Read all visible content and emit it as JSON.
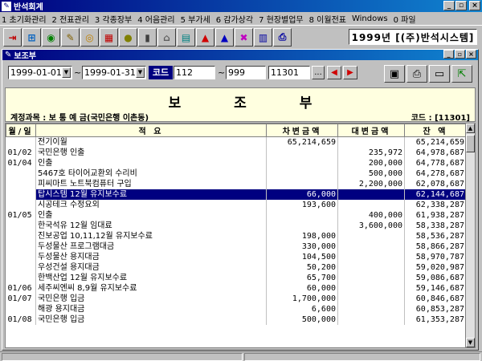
{
  "app": {
    "title": "반석회계"
  },
  "menu": [
    "1 초기화관리",
    "2 전표관리",
    "3 각종장부",
    "4 어음관리",
    "5 부가세",
    "6 감가상각",
    "7 현장별업무",
    "8 이월전표",
    "Windows",
    "0 파일"
  ],
  "toolbar": {
    "company": "1999년 [(주)반석시스템]"
  },
  "window": {
    "title": "보조부"
  },
  "filter": {
    "date_from": "1999-01-01",
    "tilde1": "~",
    "date_to": "1999-01-31",
    "code_label": "코드",
    "code_from": "112",
    "tilde2": "~",
    "code_to": "999",
    "account_code": "11301",
    "browse": "..."
  },
  "report": {
    "title": "보 조 부",
    "account": "계정과목 : 보 통 예 금(국민은행 이촌동)",
    "code": "코드 : [11301]"
  },
  "columns": [
    "월/일",
    "적 요",
    "차변금액",
    "대변금액",
    "잔 액"
  ],
  "rows": [
    {
      "date": "",
      "desc": "전기이월",
      "debit": "65,214,659",
      "credit": "",
      "balance": "65,214,659"
    },
    {
      "date": "01/02",
      "desc": "국민은행 인출",
      "debit": "",
      "credit": "235,972",
      "balance": "64,978,687"
    },
    {
      "date": "01/04",
      "desc": "인출",
      "debit": "",
      "credit": "200,000",
      "balance": "64,778,687"
    },
    {
      "date": "",
      "desc": "5467호 타이어교환외 수리비",
      "debit": "",
      "credit": "500,000",
      "balance": "64,278,687"
    },
    {
      "date": "",
      "desc": "피씨마트 노트북컴퓨터 구입",
      "debit": "",
      "credit": "2,200,000",
      "balance": "62,078,687"
    },
    {
      "date": "",
      "desc": "탑시스템 12월 유지보수료",
      "debit": "66,000",
      "credit": "",
      "balance": "62,144,687",
      "selected": true
    },
    {
      "date": "",
      "desc": "시공테크 수정요외",
      "debit": "193,600",
      "credit": "",
      "balance": "62,338,287"
    },
    {
      "date": "01/05",
      "desc": "인출",
      "debit": "",
      "credit": "400,000",
      "balance": "61,938,287"
    },
    {
      "date": "",
      "desc": "한국석유 12월 임대료",
      "debit": "",
      "credit": "3,600,000",
      "balance": "58,338,287"
    },
    {
      "date": "",
      "desc": "진보공업 10,11,12월 유지보수료",
      "debit": "198,000",
      "credit": "",
      "balance": "58,536,287"
    },
    {
      "date": "",
      "desc": "두성물산 프로그램대금",
      "debit": "330,000",
      "credit": "",
      "balance": "58,866,287"
    },
    {
      "date": "",
      "desc": "두성물산 용지대금",
      "debit": "104,500",
      "credit": "",
      "balance": "58,970,787"
    },
    {
      "date": "",
      "desc": "우성건설 용지대금",
      "debit": "50,200",
      "credit": "",
      "balance": "59,020,987"
    },
    {
      "date": "",
      "desc": "한백산업 12월 유지보수료",
      "debit": "65,700",
      "credit": "",
      "balance": "59,086,687"
    },
    {
      "date": "01/06",
      "desc": "세주씨엔씨 8,9월 유지보수료",
      "debit": "60,000",
      "credit": "",
      "balance": "59,146,687"
    },
    {
      "date": "01/07",
      "desc": "국민은행 입금",
      "debit": "1,700,000",
      "credit": "",
      "balance": "60,846,687"
    },
    {
      "date": "",
      "desc": "해광 용지대금",
      "debit": "6,600",
      "credit": "",
      "balance": "60,853,287"
    },
    {
      "date": "01/08",
      "desc": "국민은행 입금",
      "debit": "500,000",
      "credit": "",
      "balance": "61,353,287"
    }
  ]
}
